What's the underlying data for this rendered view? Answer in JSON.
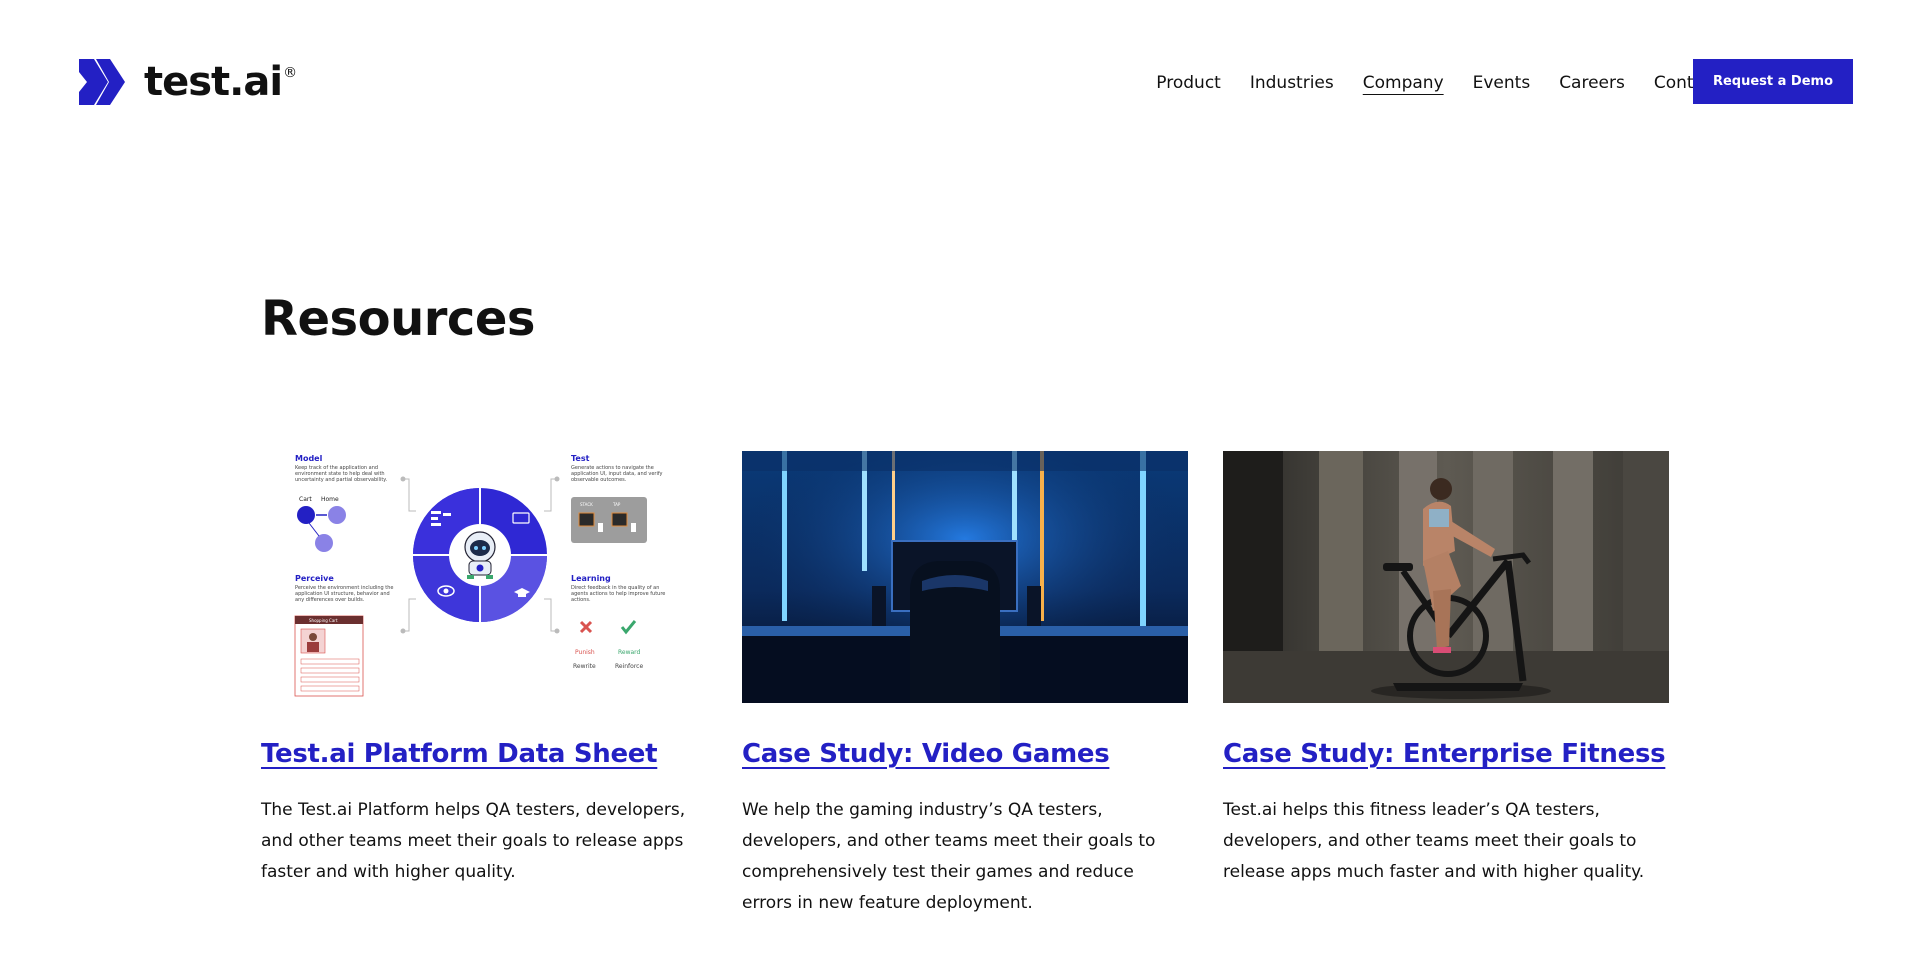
{
  "brand": {
    "name": "test.ai",
    "trademark": "®",
    "color": "#2320c4"
  },
  "nav": {
    "items": [
      {
        "label": "Product"
      },
      {
        "label": "Industries"
      },
      {
        "label": "Company",
        "active": true
      },
      {
        "label": "Events"
      },
      {
        "label": "Careers"
      },
      {
        "label": "Contact"
      }
    ],
    "cta_label": "Request a Demo"
  },
  "page": {
    "title": "Resources"
  },
  "cards": [
    {
      "title": "Test.ai Platform Data Sheet",
      "description": "The Test.ai Platform helps QA testers, developers, and other teams meet their goals to release apps faster and with higher quality.",
      "image": {
        "kind": "diagram",
        "labels": {
          "model": "Model",
          "model_text": "Keep track of the application and environment state to help deal with uncertainty and partial observability.",
          "cart": "Cart",
          "home": "Home",
          "test": "Test",
          "test_text": "Generate actions to navigate the application UI, input data, and verify observable outcomes.",
          "stack": "STACK",
          "tap": "TAP",
          "perceive": "Perceive",
          "perceive_text": "Perceive the environment including the application UI structure, behavior and any differences over builds.",
          "shopping_cart": "Shopping Cart",
          "learning": "Learning",
          "learning_text": "Direct feedback in the quality of an agents actions to help improve future actions.",
          "punish": "Punish",
          "reward": "Reward",
          "rewrite": "Rewrite",
          "reinforce": "Reinforce"
        }
      }
    },
    {
      "title": "Case Study: Video Games",
      "description": "We help the gaming industry’s QA testers, developers, and other teams meet their goals to comprehensively test their games and reduce errors in new feature deployment.",
      "image": {
        "kind": "photo",
        "subject": "gaming-setup-photo"
      }
    },
    {
      "title": "Case Study: Enterprise Fitness",
      "description": "Test.ai helps this fitness leader’s QA testers, developers, and other teams meet their goals to release apps much faster and with higher quality.",
      "image": {
        "kind": "photo",
        "subject": "exercise-bike-photo"
      }
    }
  ]
}
